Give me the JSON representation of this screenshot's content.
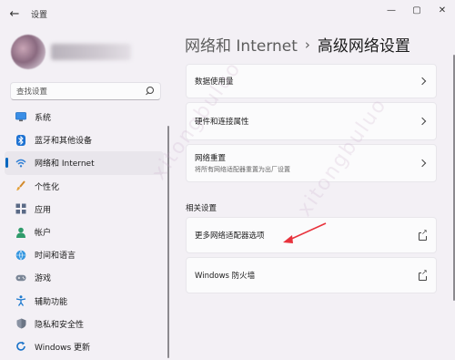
{
  "window": {
    "title": "设置",
    "controls": {
      "minimize": "—",
      "maximize": "▢",
      "close": "✕"
    }
  },
  "search": {
    "placeholder": "查找设置"
  },
  "sidebar": {
    "items": [
      {
        "label": "系统",
        "icon": "monitor-icon",
        "active": false
      },
      {
        "label": "蓝牙和其他设备",
        "icon": "bluetooth-icon",
        "active": false
      },
      {
        "label": "网络和 Internet",
        "icon": "wifi-icon",
        "active": true
      },
      {
        "label": "个性化",
        "icon": "brush-icon",
        "active": false
      },
      {
        "label": "应用",
        "icon": "apps-icon",
        "active": false
      },
      {
        "label": "帐户",
        "icon": "person-icon",
        "active": false
      },
      {
        "label": "时间和语言",
        "icon": "globe-clock-icon",
        "active": false
      },
      {
        "label": "游戏",
        "icon": "gamepad-icon",
        "active": false
      },
      {
        "label": "辅助功能",
        "icon": "accessibility-icon",
        "active": false
      },
      {
        "label": "隐私和安全性",
        "icon": "shield-icon",
        "active": false
      },
      {
        "label": "Windows 更新",
        "icon": "update-icon",
        "active": false
      }
    ]
  },
  "breadcrumb": {
    "parent": "网络和 Internet",
    "separator": "›",
    "current": "高级网络设置"
  },
  "cards": {
    "data_usage": {
      "title": "数据使用量"
    },
    "hardware": {
      "title": "硬件和连接属性"
    },
    "reset": {
      "title": "网络重置",
      "subtitle": "将所有网络适配器重置为出厂设置"
    }
  },
  "related": {
    "heading": "相关设置",
    "more_adapters": {
      "title": "更多网络适配器选项"
    },
    "firewall": {
      "title": "Windows 防火墙"
    }
  },
  "colors": {
    "accent": "#0067c0",
    "annotation_arrow": "#e8323c"
  }
}
